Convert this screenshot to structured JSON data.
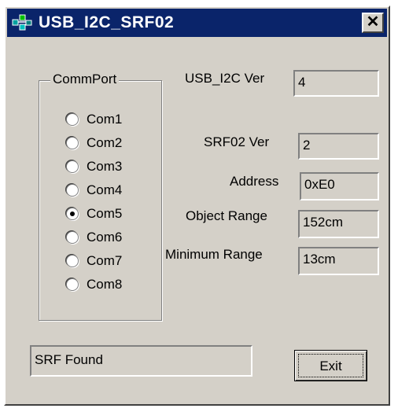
{
  "window": {
    "title": "USB_I2C_SRF02",
    "close_glyph": "✕",
    "colors": {
      "titlebar": "#0a246a",
      "face": "#d4d0c8"
    }
  },
  "commport": {
    "title": "CommPort",
    "options": [
      {
        "label": "Com1",
        "checked": false
      },
      {
        "label": "Com2",
        "checked": false
      },
      {
        "label": "Com3",
        "checked": false
      },
      {
        "label": "Com4",
        "checked": false
      },
      {
        "label": "Com5",
        "checked": true
      },
      {
        "label": "Com6",
        "checked": false
      },
      {
        "label": "Com7",
        "checked": false
      },
      {
        "label": "Com8",
        "checked": false
      }
    ]
  },
  "info": {
    "usb_i2c_ver_label": "USB_I2C Ver",
    "usb_i2c_ver_value": "4",
    "srf02_ver_label": "SRF02 Ver",
    "srf02_ver_value": "2",
    "address_label": "Address",
    "address_value": "0xE0",
    "object_range_label": "Object Range",
    "object_range_value": "152cm",
    "minimum_range_label": "Minimum Range",
    "minimum_range_value": "13cm"
  },
  "status": {
    "text": "SRF Found"
  },
  "buttons": {
    "exit_label": "Exit"
  },
  "icons": {
    "app": "usb-connector-icon",
    "close": "close-icon"
  }
}
